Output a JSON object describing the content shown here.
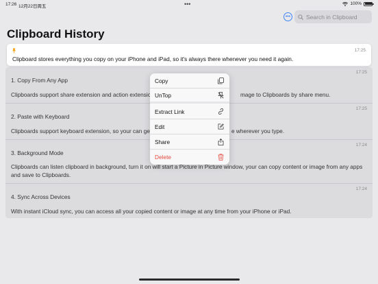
{
  "status_bar": {
    "time": "17:26",
    "date": "12月22日周五",
    "multitasking_dots": "•••",
    "battery": "100%",
    "battery_level": 1.0
  },
  "header": {
    "title": "Clipboard History",
    "more_icon": "ellipsis-circle-icon",
    "search_placeholder": "Search in Clipboard"
  },
  "pinned_item": {
    "timestamp": "17:25",
    "text": "Clipboard stores everything you copy on your iPhone and iPad, so it's always there whenever you need it again.",
    "pin_color": "#f59e0b"
  },
  "items": [
    {
      "timestamp": "17:25",
      "title": "1. Copy From Any App",
      "body_left": "Clipboards support share extension and action extension,",
      "body_right": "mage to Clipboards by share menu."
    },
    {
      "timestamp": "17:25",
      "title": "2. Paste with Keyboard",
      "body_left": "Clipboards support keyboard extension, so your can get y",
      "body_right": "e wherever you type."
    },
    {
      "timestamp": "17:24",
      "title": "3. Background Mode",
      "body": "Clipboards can listen clipboard in background, turn it on will start a Picture in Picture window, your can copy content or image from any apps and save to Clipboards."
    },
    {
      "timestamp": "17:24",
      "title": "4. Sync Across Devices",
      "body": "With instant iCloud sync, you can access all your copied content or image at any time from your iPhone or iPad."
    }
  ],
  "context_menu": {
    "items": [
      {
        "label": "Copy",
        "icon": "copy-icon"
      },
      {
        "label": "UnTop",
        "icon": "unpin-icon"
      },
      {
        "label": "Extract Link",
        "icon": "link-icon"
      },
      {
        "label": "Edit",
        "icon": "edit-icon"
      },
      {
        "label": "Share",
        "icon": "share-icon"
      },
      {
        "label": "Delete",
        "icon": "trash-icon"
      }
    ],
    "danger_color": "#e5483f"
  },
  "colors": {
    "accent": "#3b82f6",
    "background": "#e9e9ec"
  }
}
